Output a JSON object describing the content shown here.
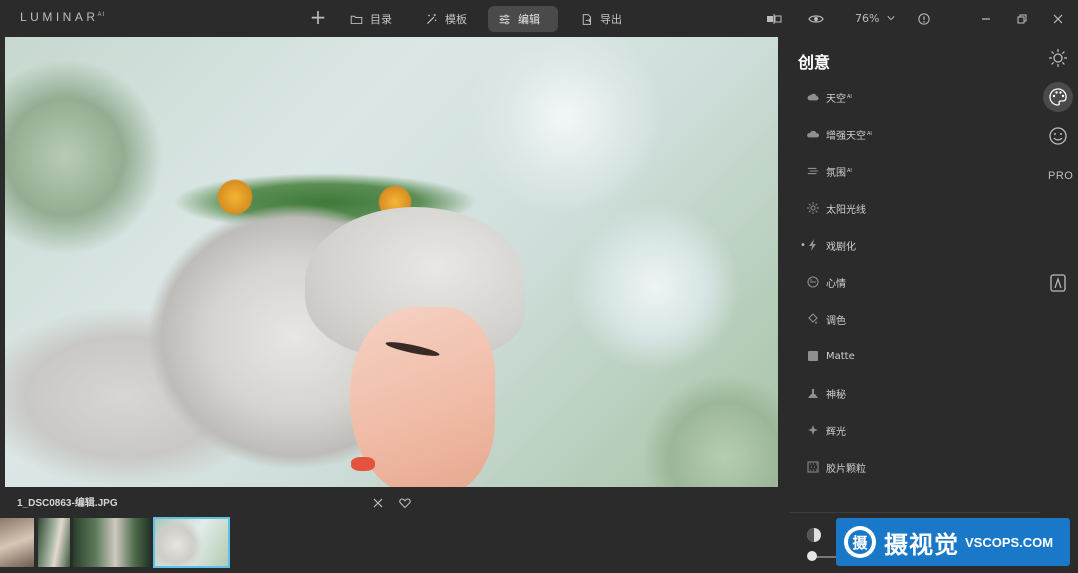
{
  "app": {
    "logo": "LUMINAR",
    "logo_sup": "AI"
  },
  "nav": {
    "catalog": "目录",
    "templates": "模板",
    "edit": "编辑",
    "export": "导出"
  },
  "topbar": {
    "zoom": "76%"
  },
  "image": {
    "filename": "1_DSC0863-编辑.JPG"
  },
  "panel": {
    "title": "创意",
    "tools": [
      {
        "label": "天空",
        "sup": "AI",
        "icon": "cloud-icon"
      },
      {
        "label": "增强天空",
        "sup": "AI",
        "icon": "cloud-plus-icon"
      },
      {
        "label": "氛围",
        "sup": "AI",
        "icon": "atmosphere-icon"
      },
      {
        "label": "太阳光线",
        "sup": "",
        "icon": "sunrays-icon"
      },
      {
        "label": "戏剧化",
        "sup": "",
        "icon": "lightning-icon"
      },
      {
        "label": "心情",
        "sup": "",
        "icon": "mood-icon"
      },
      {
        "label": "调色",
        "sup": "",
        "icon": "color-toning-icon"
      },
      {
        "label": "Matte",
        "sup": "",
        "icon": "matte-icon"
      },
      {
        "label": "神秘",
        "sup": "",
        "icon": "mystical-icon"
      },
      {
        "label": "辉光",
        "sup": "",
        "icon": "glow-icon"
      },
      {
        "label": "胶片颗粒",
        "sup": "",
        "icon": "film-grain-icon"
      }
    ],
    "rail_pro": "PRO"
  },
  "watermark": {
    "cn": "摄视觉",
    "en": "VSCOPS.COM",
    "badge": "摄"
  },
  "colors": {
    "accent": "#5ec2e6",
    "background": "#2b2b2b",
    "active_button": "#4a4a4a",
    "watermark": "#1a78c8"
  }
}
